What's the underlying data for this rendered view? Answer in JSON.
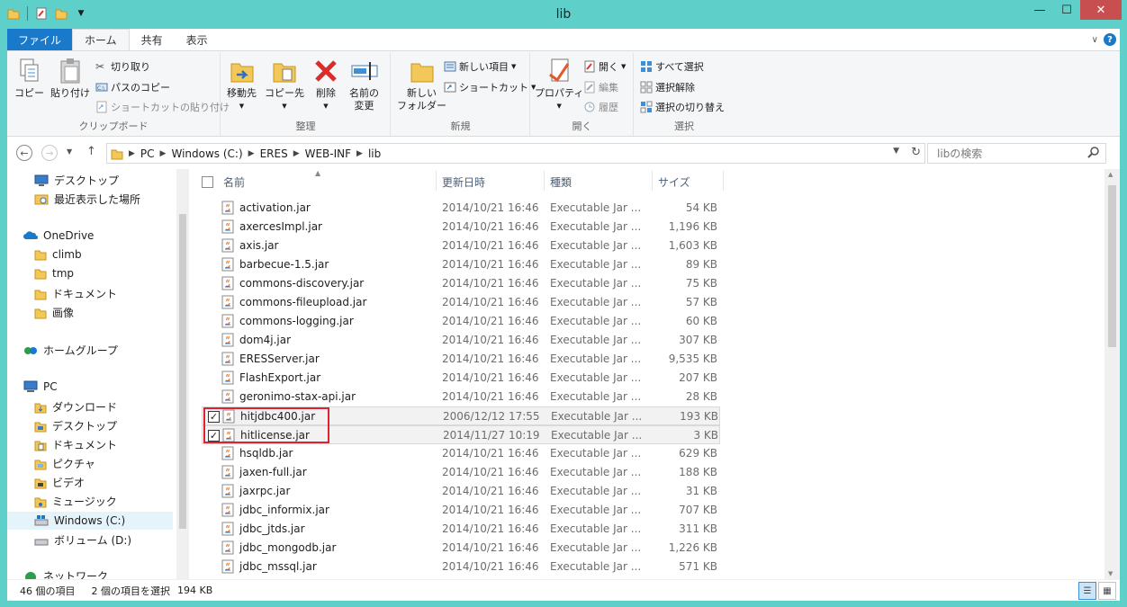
{
  "window": {
    "title": "lib"
  },
  "ribbon_tabs": {
    "file": "ファイル",
    "home": "ホーム",
    "share": "共有",
    "view": "表示"
  },
  "ribbon": {
    "clipboard": {
      "copy": "コピー",
      "paste": "貼り付け",
      "cut": "切り取り",
      "copy_path": "パスのコピー",
      "paste_shortcut": "ショートカットの貼り付け",
      "label": "クリップボード"
    },
    "organize": {
      "move_to": "移動先",
      "copy_to": "コピー先",
      "delete": "削除",
      "rename_line1": "名前の",
      "rename_line2": "変更",
      "label": "整理"
    },
    "new": {
      "new_folder_line1": "新しい",
      "new_folder_line2": "フォルダー",
      "new_item": "新しい項目",
      "shortcut": "ショートカット",
      "label": "新規"
    },
    "open": {
      "properties": "プロパティ",
      "open": "開く",
      "edit": "編集",
      "history": "履歴",
      "label": "開く"
    },
    "select": {
      "select_all": "すべて選択",
      "select_none": "選択解除",
      "invert": "選択の切り替え",
      "label": "選択"
    }
  },
  "address": {
    "crumbs": [
      "PC",
      "Windows (C:)",
      "ERES",
      "WEB-INF",
      "lib"
    ],
    "search_placeholder": "libの検索"
  },
  "nav": {
    "desktop": "デスクトップ",
    "recent": "最近表示した場所",
    "onedrive": "OneDrive",
    "climb": "climb",
    "tmp": "tmp",
    "documents": "ドキュメント",
    "pictures": "画像",
    "homegroup": "ホームグループ",
    "pc": "PC",
    "downloads": "ダウンロード",
    "pc_desktop": "デスクトップ",
    "pc_documents": "ドキュメント",
    "pc_pictures": "ピクチャ",
    "videos": "ビデオ",
    "music": "ミュージック",
    "windows_c": "Windows (C:)",
    "volume_d": "ボリューム (D:)",
    "network": "ネットワーク"
  },
  "columns": {
    "name": "名前",
    "modified": "更新日時",
    "type": "種類",
    "size": "サイズ"
  },
  "files": [
    {
      "name": "activation.jar",
      "date": "2014/10/21 16:46",
      "type": "Executable Jar ...",
      "size": "54 KB",
      "selected": false
    },
    {
      "name": "axercesImpl.jar",
      "date": "2014/10/21 16:46",
      "type": "Executable Jar ...",
      "size": "1,196 KB",
      "selected": false
    },
    {
      "name": "axis.jar",
      "date": "2014/10/21 16:46",
      "type": "Executable Jar ...",
      "size": "1,603 KB",
      "selected": false
    },
    {
      "name": "barbecue-1.5.jar",
      "date": "2014/10/21 16:46",
      "type": "Executable Jar ...",
      "size": "89 KB",
      "selected": false
    },
    {
      "name": "commons-discovery.jar",
      "date": "2014/10/21 16:46",
      "type": "Executable Jar ...",
      "size": "75 KB",
      "selected": false
    },
    {
      "name": "commons-fileupload.jar",
      "date": "2014/10/21 16:46",
      "type": "Executable Jar ...",
      "size": "57 KB",
      "selected": false
    },
    {
      "name": "commons-logging.jar",
      "date": "2014/10/21 16:46",
      "type": "Executable Jar ...",
      "size": "60 KB",
      "selected": false
    },
    {
      "name": "dom4j.jar",
      "date": "2014/10/21 16:46",
      "type": "Executable Jar ...",
      "size": "307 KB",
      "selected": false
    },
    {
      "name": "ERESServer.jar",
      "date": "2014/10/21 16:46",
      "type": "Executable Jar ...",
      "size": "9,535 KB",
      "selected": false
    },
    {
      "name": "FlashExport.jar",
      "date": "2014/10/21 16:46",
      "type": "Executable Jar ...",
      "size": "207 KB",
      "selected": false
    },
    {
      "name": "geronimo-stax-api.jar",
      "date": "2014/10/21 16:46",
      "type": "Executable Jar ...",
      "size": "28 KB",
      "selected": false
    },
    {
      "name": "hitjdbc400.jar",
      "date": "2006/12/12 17:55",
      "type": "Executable Jar ...",
      "size": "193 KB",
      "selected": true
    },
    {
      "name": "hitlicense.jar",
      "date": "2014/11/27 10:19",
      "type": "Executable Jar ...",
      "size": "3 KB",
      "selected": true
    },
    {
      "name": "hsqldb.jar",
      "date": "2014/10/21 16:46",
      "type": "Executable Jar ...",
      "size": "629 KB",
      "selected": false
    },
    {
      "name": "jaxen-full.jar",
      "date": "2014/10/21 16:46",
      "type": "Executable Jar ...",
      "size": "188 KB",
      "selected": false
    },
    {
      "name": "jaxrpc.jar",
      "date": "2014/10/21 16:46",
      "type": "Executable Jar ...",
      "size": "31 KB",
      "selected": false
    },
    {
      "name": "jdbc_informix.jar",
      "date": "2014/10/21 16:46",
      "type": "Executable Jar ...",
      "size": "707 KB",
      "selected": false
    },
    {
      "name": "jdbc_jtds.jar",
      "date": "2014/10/21 16:46",
      "type": "Executable Jar ...",
      "size": "311 KB",
      "selected": false
    },
    {
      "name": "jdbc_mongodb.jar",
      "date": "2014/10/21 16:46",
      "type": "Executable Jar ...",
      "size": "1,226 KB",
      "selected": false
    },
    {
      "name": "jdbc_mssql.jar",
      "date": "2014/10/21 16:46",
      "type": "Executable Jar ...",
      "size": "571 KB",
      "selected": false
    }
  ],
  "status": {
    "count": "46 個の項目",
    "selected": "2 個の項目を選択",
    "size": "194 KB"
  },
  "colors": {
    "accent": "#1979ca",
    "title_bg": "#5ed0c9",
    "highlight": "#e0212e"
  }
}
